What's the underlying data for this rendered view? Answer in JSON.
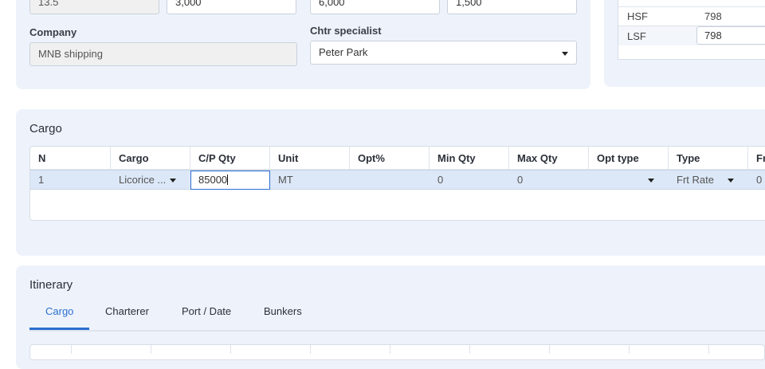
{
  "top_form": {
    "row1": {
      "field_a": "13.5",
      "field_b": "3,000",
      "field_c": "6,000",
      "field_d": "1,500"
    },
    "company": {
      "label": "Company",
      "value": "MNB shipping"
    },
    "chtr_specialist": {
      "label": "Chtr specialist",
      "value": "Peter Park"
    }
  },
  "bunker_table": {
    "rows": [
      {
        "grade": "HSF",
        "value": "798"
      },
      {
        "grade": "LSF",
        "value": "798"
      }
    ]
  },
  "cargo": {
    "title": "Cargo",
    "columns": [
      "N",
      "Cargo",
      "C/P Qty",
      "Unit",
      "Opt%",
      "Min Qty",
      "Max Qty",
      "Opt type",
      "Type",
      "Fr"
    ],
    "row": {
      "n": "1",
      "cargo": "Licorice ...",
      "cp_qty": "85000",
      "unit": "MT",
      "opt_pct": "",
      "min_qty": "0",
      "max_qty": "0",
      "opt_type": "",
      "type": "Frt Rate",
      "fr": "0"
    }
  },
  "itinerary": {
    "title": "Itinerary",
    "tabs": [
      "Cargo",
      "Charterer",
      "Port / Date",
      "Bunkers"
    ],
    "active_tab": "Cargo"
  },
  "colors": {
    "accent": "#2c6fcf",
    "panel": "#eef3fb",
    "row_highlight": "#dce8f8"
  }
}
